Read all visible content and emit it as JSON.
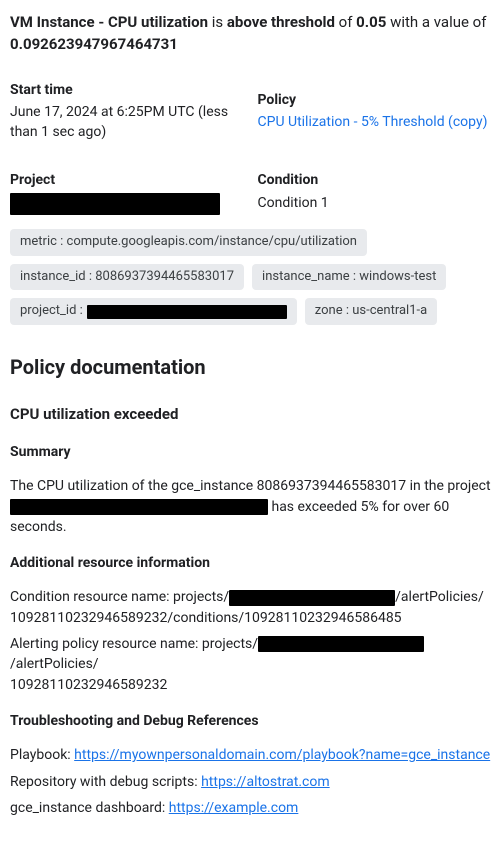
{
  "title": {
    "seg1": "VM Instance - CPU utilization",
    "seg2": " is ",
    "seg3": "above threshold",
    "seg4": " of ",
    "seg5": "0.05",
    "seg6": " with a value of ",
    "seg7": "0.092623947967464731"
  },
  "info": {
    "start_label": "Start time",
    "start_value": "June 17, 2024 at 6:25PM UTC (less than 1 sec ago)",
    "policy_label": "Policy",
    "policy_link": "CPU Utilization - 5% Threshold (copy)",
    "project_label": "Project",
    "condition_label": "Condition",
    "condition_value": "Condition 1"
  },
  "chips": {
    "metric": "metric : compute.googleapis.com/instance/cpu/utilization",
    "instance_id": "instance_id : 8086937394465583017",
    "instance_name": "instance_name : windows-test",
    "project_id_key": "project_id :",
    "zone": "zone : us-central1-a"
  },
  "doc": {
    "heading": "Policy documentation",
    "sub1": "CPU utilization exceeded",
    "summary_h": "Summary",
    "summary_p1a": "The CPU utilization of the gce_instance 8086937394465583017 in the project ",
    "summary_p1b": " has exceeded 5% for over 60 seconds.",
    "addl_h": "Additional resource information",
    "cond_a": "Condition resource name: projects/",
    "cond_b": "/alertPolicies/",
    "cond_c": "10928110232946589232/conditions/10928110232946586485",
    "alert_a": "Alerting policy resource name: projects/",
    "alert_b": "/alertPolicies/",
    "alert_c": "10928110232946589232",
    "trouble_h": "Troubleshooting and Debug References",
    "playbook_label": "Playbook: ",
    "playbook_link": "https://myownpersonaldomain.com/playbook?name=gce_instance",
    "repo_label": "Repository with debug scripts: ",
    "repo_link": "https://altostrat.com",
    "dash_label": "gce_instance dashboard: ",
    "dash_link": "https://example.com"
  }
}
